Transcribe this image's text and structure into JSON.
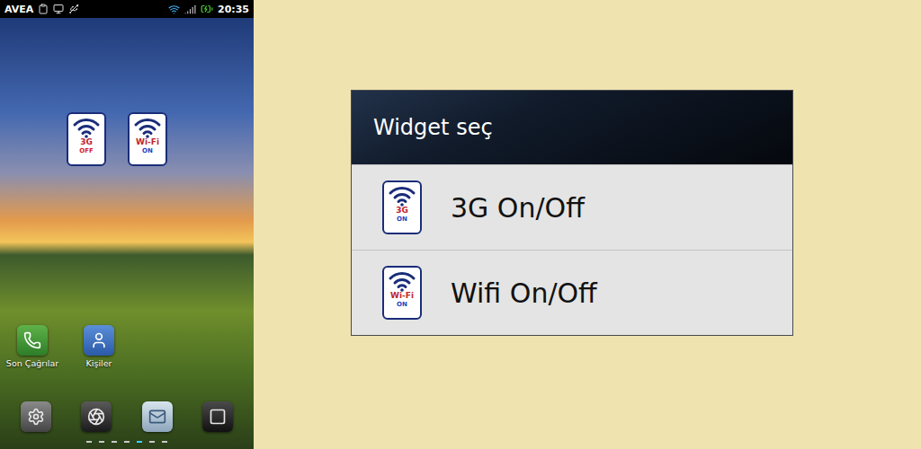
{
  "phone": {
    "status_bar": {
      "carrier": "AVEA",
      "time": "20:35",
      "wifi_on": true,
      "charging": true
    },
    "widgets": [
      {
        "label": "3G",
        "state": "OFF",
        "on": false
      },
      {
        "label": "Wi-Fi",
        "state": "ON",
        "on": true
      }
    ],
    "apps": [
      {
        "label": "Son Çağrılar",
        "kind": "calls"
      },
      {
        "label": "Kişiler",
        "kind": "contacts"
      }
    ],
    "page_dots": [
      {
        "selected": false
      },
      {
        "selected": false
      },
      {
        "selected": false
      },
      {
        "selected": false
      },
      {
        "selected": true
      },
      {
        "selected": false
      },
      {
        "selected": false
      }
    ]
  },
  "dialog": {
    "title": "Widget seç",
    "items": [
      {
        "title": "3G On/Off",
        "icon_label": "3G",
        "icon_state": "ON",
        "on": true
      },
      {
        "title": "Wifi On/Off",
        "icon_label": "Wi-Fi",
        "icon_state": "ON",
        "on": true
      }
    ]
  }
}
